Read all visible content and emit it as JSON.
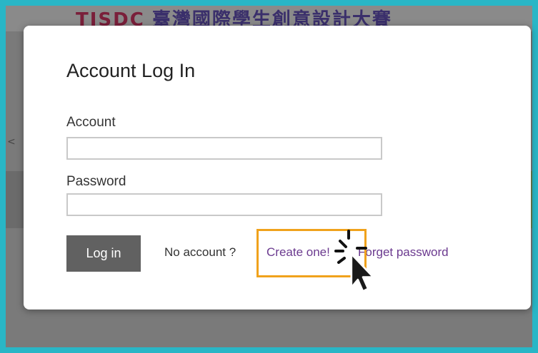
{
  "background": {
    "logo_text": "TISDC",
    "header_text": "臺灣國際學生創意設計大賽"
  },
  "modal": {
    "title": "Account Log In",
    "account_label": "Account",
    "account_value": "",
    "password_label": "Password",
    "password_value": "",
    "login_button": "Log in",
    "no_account_text": "No account ?",
    "create_link": "Create one!",
    "forgot_link": "Forget password"
  },
  "annotation": {
    "highlight_color": "#f0a21c",
    "cursor_icon": "pointer-arrow-icon"
  }
}
